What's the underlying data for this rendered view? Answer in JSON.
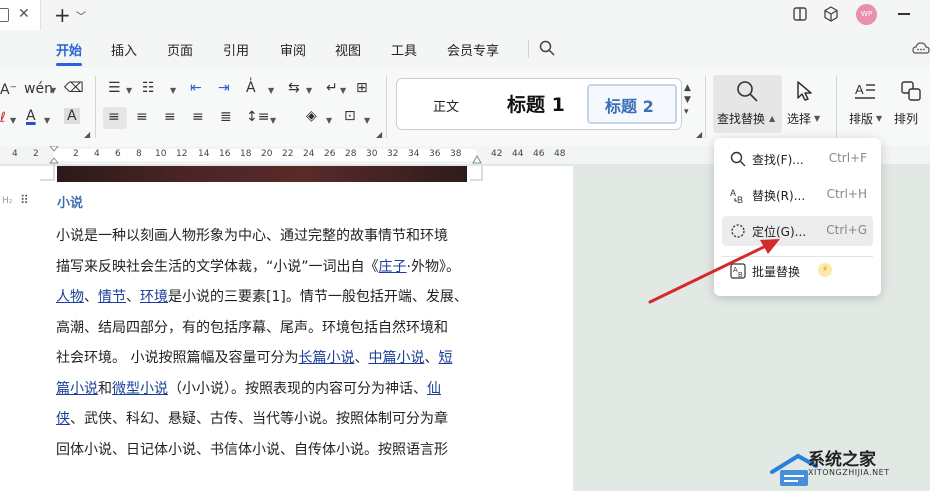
{
  "titlebar": {
    "new_tab_icon": "plus-icon",
    "avatar_text": "WP"
  },
  "menu": {
    "items": [
      "开始",
      "插入",
      "页面",
      "引用",
      "审阅",
      "视图",
      "工具",
      "会员专享"
    ],
    "active": "开始"
  },
  "styles": {
    "normal": "正文",
    "heading1": "标题 1",
    "heading2": "标题 2"
  },
  "ribbon": {
    "find_replace_label": "查找替换",
    "select_label": "选择",
    "layout_label": "排版",
    "arrange_label": "排列"
  },
  "ruler": {
    "numbers": [
      "4",
      "2",
      "",
      "2",
      "4",
      "6",
      "8",
      "10",
      "12",
      "14",
      "16",
      "18",
      "20",
      "22",
      "24",
      "26",
      "28",
      "30",
      "32",
      "34",
      "36",
      "38",
      "",
      "42",
      "44",
      "46",
      "48"
    ]
  },
  "document": {
    "heading_mark": "H₂",
    "heading": "小说",
    "lines": [
      [
        {
          "t": "小说是一种以刻画人物形象为中心、通过完整的故事情节和环境"
        }
      ],
      [
        {
          "t": "描写来反映社会生活的文学体裁，“小说”一词出自《"
        },
        {
          "t": "庄子",
          "link": true
        },
        {
          "t": "·外物》。"
        }
      ],
      [
        {
          "t": "人物",
          "link": true
        },
        {
          "t": "、"
        },
        {
          "t": "情节",
          "link": true
        },
        {
          "t": "、"
        },
        {
          "t": "环境",
          "link": true
        },
        {
          "t": "是小说的三要素[1]。情节一般包括开端、发展、"
        }
      ],
      [
        {
          "t": "高潮、结局四部分，有的包括序幕、尾声。环境包括自然环境和"
        }
      ],
      [
        {
          "t": "社会环境。 小说按照篇幅及容量可分为"
        },
        {
          "t": "长篇小说",
          "link": true
        },
        {
          "t": "、"
        },
        {
          "t": "中篇小说",
          "link": true
        },
        {
          "t": "、"
        },
        {
          "t": "短",
          "link": true
        }
      ],
      [
        {
          "t": "篇小说",
          "link": true
        },
        {
          "t": "和"
        },
        {
          "t": "微型小说",
          "link": true
        },
        {
          "t": "（小小说）。按照表现的内容可分为神话、"
        },
        {
          "t": "仙",
          "link": true
        }
      ],
      [
        {
          "t": "侠",
          "link": true
        },
        {
          "t": "、武侠、科幻、悬疑、古传、当代等小说。按照体制可分为章"
        }
      ],
      [
        {
          "t": "回体小说、日记体小说、书信体小说、自传体小说。按照语言形"
        }
      ]
    ]
  },
  "dropdown": {
    "items": [
      {
        "label": "查找(F)...",
        "shortcut": "Ctrl+F",
        "icon": "search-icon"
      },
      {
        "label": "替换(R)...",
        "shortcut": "Ctrl+H",
        "icon": "replace-icon"
      },
      {
        "label": "定位(G)...",
        "shortcut": "Ctrl+G",
        "icon": "locate-icon",
        "highlighted": true
      },
      {
        "label": "批量替换",
        "shortcut": "",
        "icon": "batch-replace-icon"
      }
    ]
  },
  "watermark": {
    "title": "系统之家",
    "sub": "XITONGZHIJIA.NET"
  },
  "colors": {
    "accent": "#2a62d8",
    "link": "#1a3f99",
    "heading": "#3f6fb0",
    "arrow": "#d42a2a"
  }
}
